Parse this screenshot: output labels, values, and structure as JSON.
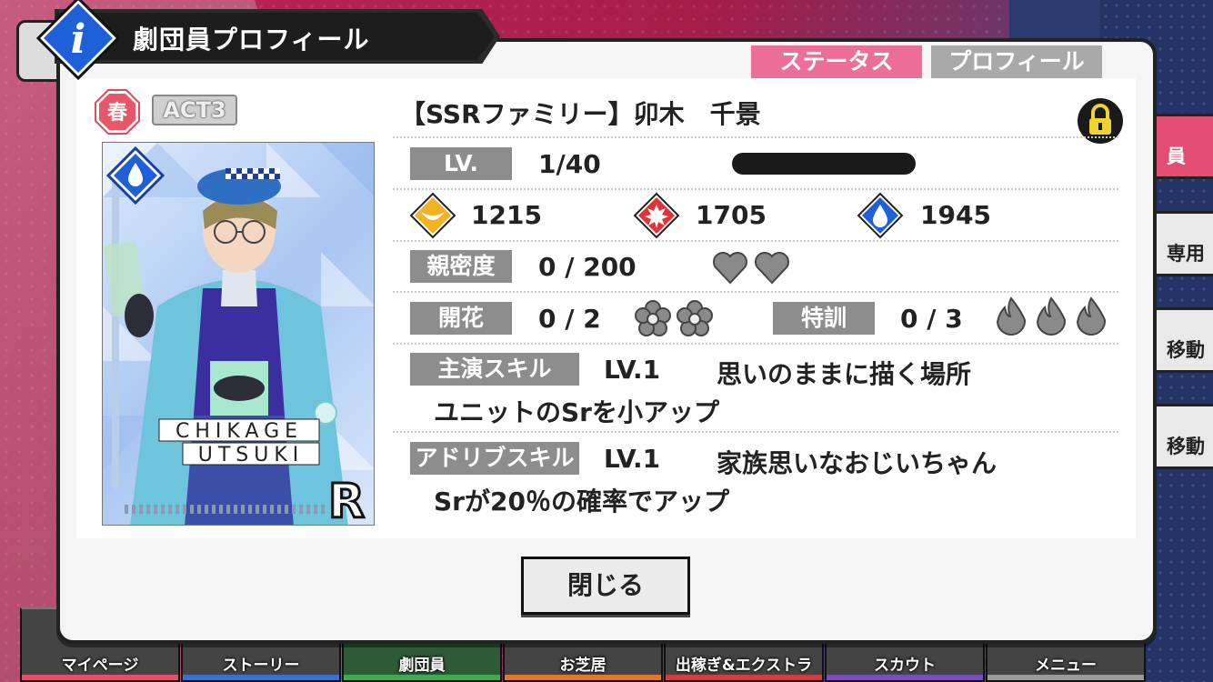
{
  "header": {
    "title": "劇団員プロフィール"
  },
  "tabs": {
    "status": "ステータス",
    "profile": "プロフィール"
  },
  "card": {
    "season": "春",
    "act": "ACT3",
    "name": "【SSRファミリー】卯木　千景",
    "name_plate": [
      "CHIKAGE",
      "UTSUKI"
    ],
    "rarity_mark": "R"
  },
  "level": {
    "label": "LV.",
    "value": "1/40",
    "progress": 0.0
  },
  "stats": {
    "stat1": "1215",
    "stat2": "1705",
    "stat3": "1945"
  },
  "intimacy": {
    "label": "親密度",
    "value": "0 / 200",
    "hearts": 2
  },
  "bloom": {
    "label": "開花",
    "value": "0 / 2",
    "flowers": 2
  },
  "training": {
    "label": "特訓",
    "value": "0 / 3",
    "flames": 3
  },
  "lead_skill": {
    "label": "主演スキル",
    "level": "LV.1",
    "name": "思いのままに描く場所",
    "desc": "ユニットのSrを小アップ"
  },
  "ad_lib_skill": {
    "label": "アドリブスキル",
    "level": "LV.1",
    "name": "家族思いなおじいちゃん",
    "desc": "Srが20％の確率でアップ"
  },
  "close_button": "閉じる",
  "side_tabs": [
    "員",
    "専用",
    "移動",
    "移動"
  ],
  "bottom_nav": [
    "マイページ",
    "ストーリー",
    "劇団員",
    "お芝居",
    "出稼ぎ&エクストラ",
    "スカウト",
    "メニュー"
  ],
  "colors": {
    "accent_pink": "#ec6f9a",
    "label_gray": "#8d8d8d",
    "nav_stripes": [
      "#e84c6b",
      "#3a6fd6",
      "#3cab4c",
      "#e8742c",
      "#d43c3c",
      "#7a4cc0",
      "#9a9a9a"
    ]
  },
  "icons": {
    "header": "info-icon",
    "lock": "lock-icon",
    "stat1": "crescent-diamond-icon",
    "stat2": "burst-diamond-icon",
    "stat3": "drop-diamond-icon"
  }
}
